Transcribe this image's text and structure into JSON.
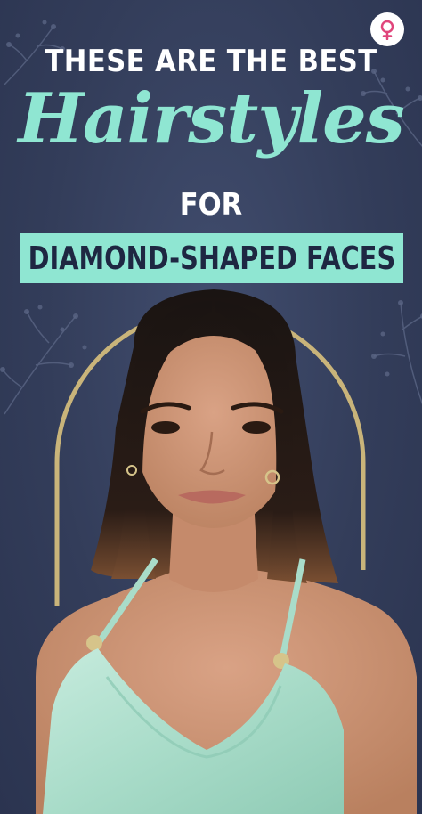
{
  "brand": {
    "logo_icon": "female-symbol-icon",
    "accent": "#e0457b"
  },
  "headline": {
    "line1": "THESE ARE THE BEST",
    "script": "Hairstyles",
    "line3": "FOR",
    "banner": "DIAMOND-SHAPED FACES"
  },
  "colors": {
    "background": "#343e5c",
    "mint": "#8fe6d2",
    "white": "#ffffff",
    "gold_arch": "#c9b47a"
  }
}
